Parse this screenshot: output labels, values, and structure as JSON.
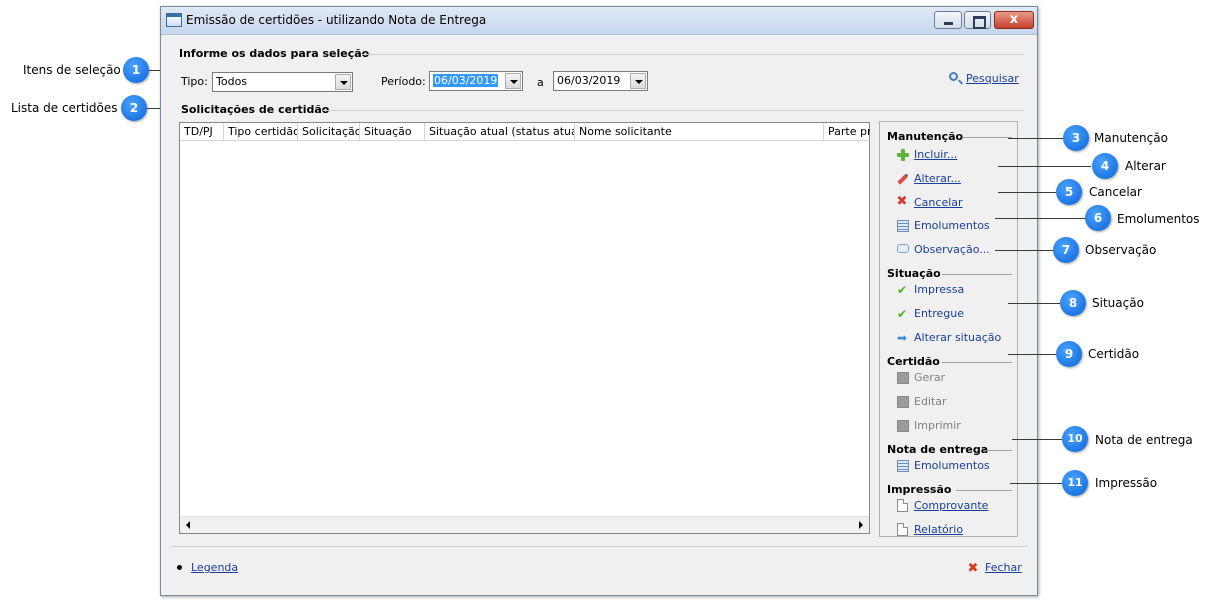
{
  "window": {
    "title": "Emissão de certidões - utilizando Nota de Entrega",
    "close_glyph": "x"
  },
  "selection": {
    "header": "Informe os dados para seleção",
    "tipo_label": "Tipo:",
    "tipo_value": "Todos",
    "periodo_label": "Período:",
    "date_from": "06/03/2019",
    "between_label": "a",
    "date_to": "06/03/2019",
    "search_label": "Pesquisar"
  },
  "list": {
    "header": "Solicitações de certidão",
    "columns": [
      "TD/PJ",
      "Tipo certidão",
      "Solicitação",
      "Situação",
      "Situação atual (status atual)",
      "Nome solicitante",
      "Parte pro"
    ]
  },
  "panel": {
    "manutencao": {
      "header": "Manutenção",
      "items": [
        "Incluir...",
        "Alterar...",
        "Cancelar",
        "Emolumentos",
        "Observação..."
      ]
    },
    "situacao": {
      "header": "Situação",
      "items": [
        "Impressa",
        "Entregue",
        "Alterar situação"
      ]
    },
    "certidao": {
      "header": "Certidão",
      "items": [
        "Gerar",
        "Editar",
        "Imprimir"
      ]
    },
    "nota": {
      "header": "Nota de entrega",
      "items": [
        "Emolumentos"
      ]
    },
    "impressao": {
      "header": "Impressão",
      "items": [
        "Comprovante",
        "Relatório"
      ]
    }
  },
  "footer": {
    "legend_label": "Legenda",
    "close_label": "Fechar"
  },
  "callouts": [
    {
      "num": "1",
      "label": "Itens de seleção"
    },
    {
      "num": "2",
      "label": "Lista de certidões"
    },
    {
      "num": "3",
      "label": "Manutenção"
    },
    {
      "num": "4",
      "label": "Alterar"
    },
    {
      "num": "5",
      "label": "Cancelar"
    },
    {
      "num": "6",
      "label": "Emolumentos"
    },
    {
      "num": "7",
      "label": "Observação"
    },
    {
      "num": "8",
      "label": "Situação"
    },
    {
      "num": "9",
      "label": "Certidão"
    },
    {
      "num": "10",
      "label": "Nota de entrega"
    },
    {
      "num": "11",
      "label": "Impressão"
    }
  ],
  "icons": {
    "title": "window-icon",
    "search": "magnifier-icon",
    "incluir": "plus-icon",
    "alterar": "pencil-icon",
    "cancelar": "red-x-icon",
    "emolumentos": "list-icon",
    "observacao": "speech-bubble-icon",
    "impressa": "check-icon",
    "entregue": "check-icon",
    "alterar_situacao": "arrow-right-icon",
    "certidao": "gray-square-icon",
    "comprovante": "document-icon",
    "relatorio": "document-icon",
    "fechar": "red-x-icon"
  },
  "colors": {
    "callout": "#1478f0",
    "link": "#1a3f9a",
    "selection": "#3399ff",
    "close_button": "#c4402a"
  }
}
